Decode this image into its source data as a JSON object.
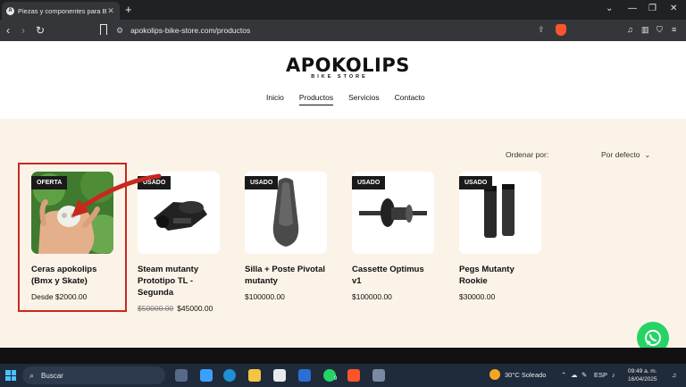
{
  "browser": {
    "tab_title": "Piezas y componentes para BM",
    "tab_favicon": "A",
    "new_tab": "+",
    "url": "apokolips-bike-store.com/productos"
  },
  "site": {
    "logo_main": "APOKOLIPS",
    "logo_sub": "BIKE STORE",
    "nav": [
      "Inicio",
      "Productos",
      "Servicios",
      "Contacto"
    ],
    "active_nav": "Productos"
  },
  "shop": {
    "sort_label": "Ordenar por:",
    "sort_value": "Por defecto",
    "products": [
      {
        "badge": "OFERTA",
        "name": "Ceras apokolips (Bmx y Skate)",
        "old_price": "",
        "price": "Desde $2000.00"
      },
      {
        "badge": "USADO",
        "name": "Steam mutanty Prototipo TL - Segunda",
        "old_price": "$50000.00",
        "price": "$45000.00"
      },
      {
        "badge": "USADO",
        "name": "Silla + Poste Pivotal mutanty",
        "old_price": "",
        "price": "$100000.00"
      },
      {
        "badge": "USADO",
        "name": "Cassette Optimus v1",
        "old_price": "",
        "price": "$100000.00"
      },
      {
        "badge": "USADO",
        "name": "Pegs Mutanty Rookie",
        "old_price": "",
        "price": "$30000.00"
      }
    ]
  },
  "taskbar": {
    "search_placeholder": "Buscar",
    "weather": "30°C  Soleado",
    "lang": "ESP",
    "time": "09:49 a. m.",
    "date": "16/04/2025",
    "notif_count": "9"
  },
  "colors": {
    "accent_red": "#c8281e",
    "shop_bg": "#fcf3e8",
    "whatsapp": "#25d366"
  }
}
